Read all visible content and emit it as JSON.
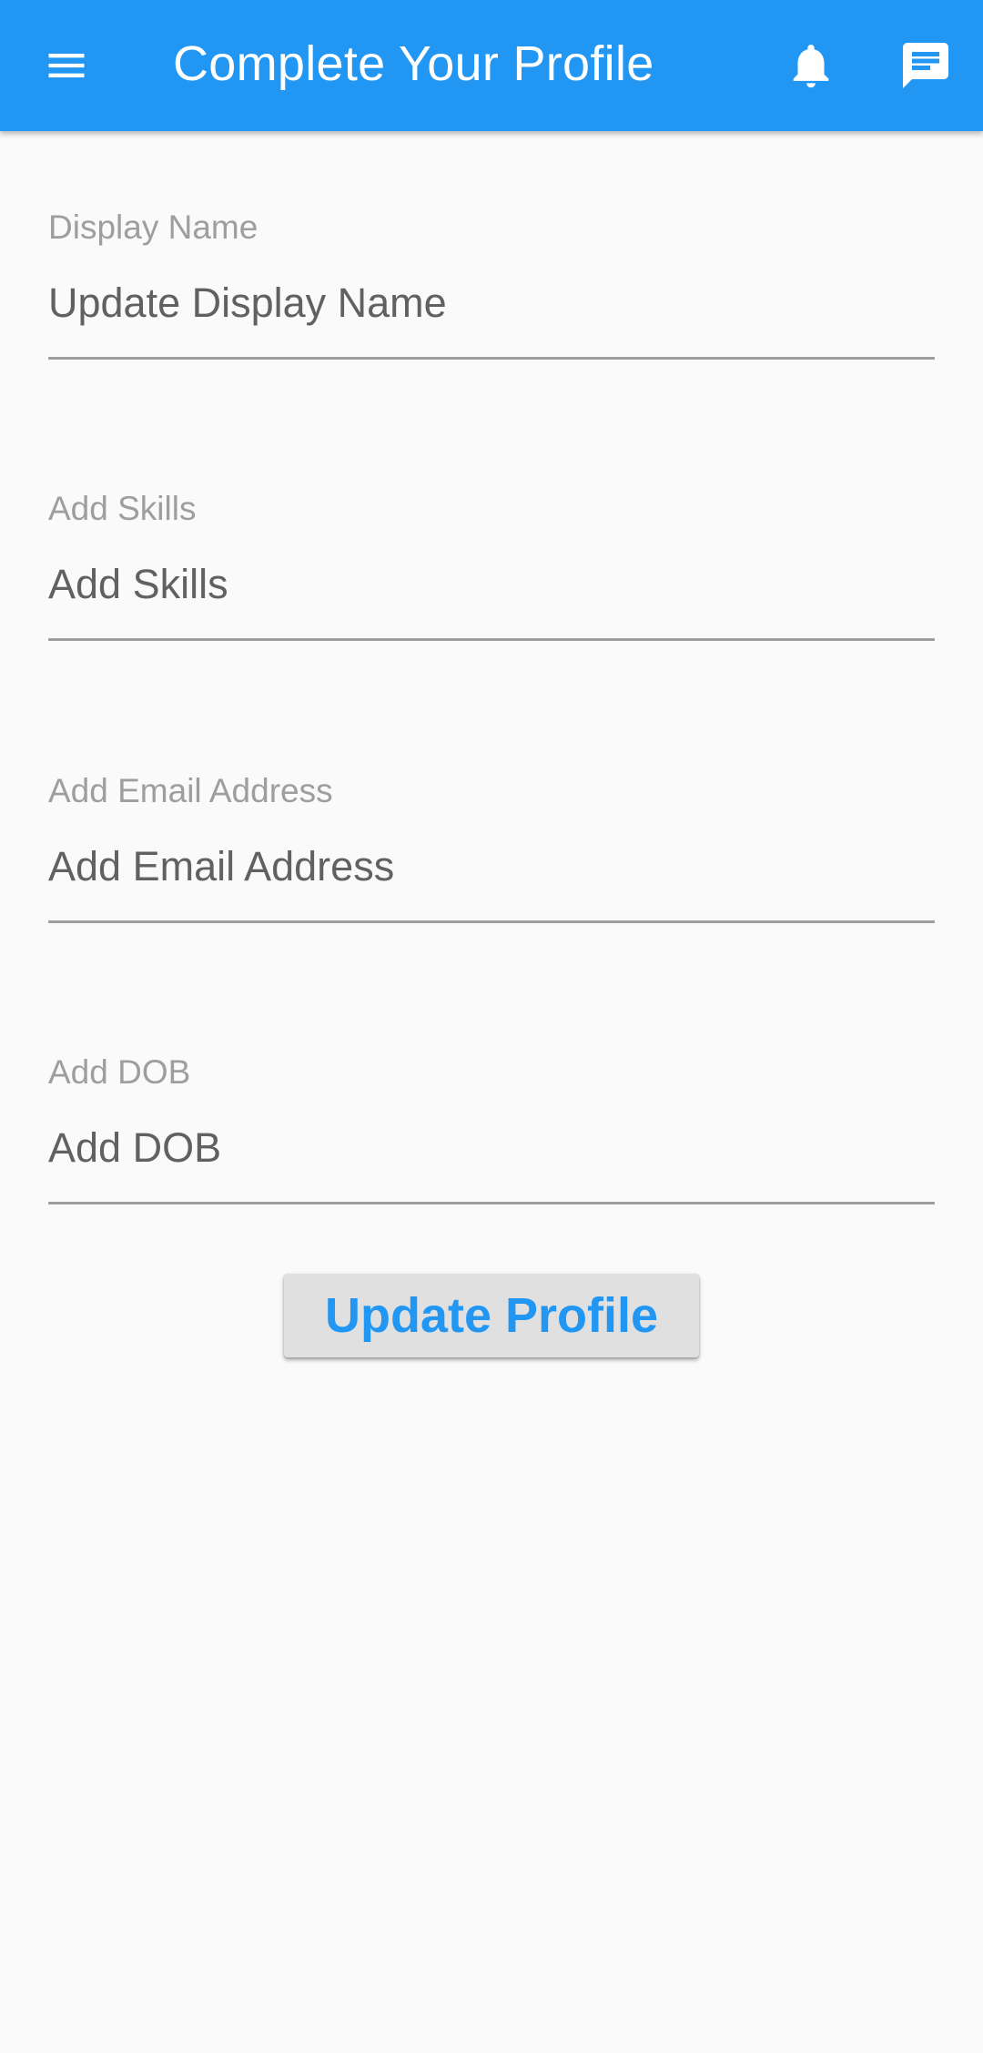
{
  "theme": {
    "primary": "#2196f3",
    "background": "#fafafa",
    "button_bg": "#e0e0e0",
    "label_color": "#9e9e9e",
    "hint_color": "#616161"
  },
  "appbar": {
    "title": "Complete Your Profile",
    "leading_icon": "menu-icon",
    "actions": [
      "notifications-bell-icon",
      "chat-message-icon"
    ]
  },
  "form": {
    "fields": [
      {
        "label": "Display Name",
        "hint": "Update Display Name"
      },
      {
        "label": "Add Skills",
        "hint": "Add Skills"
      },
      {
        "label": "Add Email Address",
        "hint": "Add Email Address"
      },
      {
        "label": "Add DOB",
        "hint": "Add DOB"
      }
    ],
    "submit_label": "Update Profile"
  }
}
